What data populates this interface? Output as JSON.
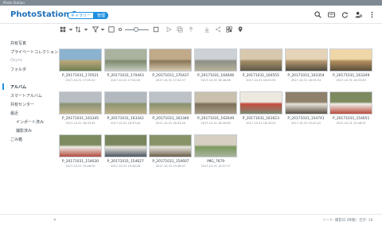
{
  "window": {
    "title": "Photo Station"
  },
  "app": {
    "name": "PhotoStation",
    "version": "5"
  },
  "mode_switch": {
    "gallery": "ギャラリー",
    "manage": "管理"
  },
  "sidebar": {
    "shared_photos": "共有写真",
    "private_collection": "プライベートコレクション",
    "qsync": "Qsync",
    "folder": "フォルダ",
    "album": "アルバム",
    "smart_album": "スマートアルバム",
    "share_center": "共有センター",
    "recent": "最近",
    "imported": "インポート済み",
    "taken": "撮影済み",
    "trash": "ごみ箱"
  },
  "photos": [
    {
      "name": "P_20171031_170521",
      "date": "2017-10-31 17:05:22",
      "colors": [
        "#8bb2cf",
        "#b9a77a",
        "#6f7f52"
      ]
    },
    {
      "name": "P_20171031_170443",
      "date": "2017-10-31 17:04:43",
      "colors": [
        "#a9b39e",
        "#7c8a6d",
        "#c7ccc0"
      ]
    },
    {
      "name": "P_20171031_170437",
      "date": "2017-10-31 17:04:37",
      "colors": [
        "#c0aa8a",
        "#8a7758",
        "#d8c9b0"
      ]
    },
    {
      "name": "P_20171031_164606",
      "date": "2017-10-31 16:46:06",
      "colors": [
        "#ccd2d6",
        "#8d8f86",
        "#b7b29c"
      ]
    },
    {
      "name": "P_20171031_164555",
      "date": "2017-10-31 16:45:55",
      "colors": [
        "#d7c8ae",
        "#a38d66",
        "#5f5a4b"
      ]
    },
    {
      "name": "P_20171031_163354",
      "date": "2017-10-31 16:33:54",
      "colors": [
        "#e6d4b8",
        "#b69871",
        "#4e4a3d"
      ]
    },
    {
      "name": "P_20171031_163349",
      "date": "2017-10-31 16:33:49",
      "colors": [
        "#f0d7a8",
        "#b48f5d",
        "#5a4f3c"
      ]
    },
    {
      "name": "P_20171031_163345",
      "date": "2017-10-31 16:33:45",
      "colors": [
        "#b8bec2",
        "#8a9274",
        "#c2b58f"
      ]
    },
    {
      "name": "P_20171031_163342",
      "date": "2017-10-31 16:33:42",
      "colors": [
        "#b2b9be",
        "#8c9570",
        "#bfb089"
      ]
    },
    {
      "name": "P_20171031_163340",
      "date": "2017-10-31 16:33:40",
      "colors": [
        "#bcc2c6",
        "#88906f",
        "#c4b68f"
      ]
    },
    {
      "name": "P_20171031_162649",
      "date": "2017-10-31 16:26:49",
      "colors": [
        "#c9c0ad",
        "#7e6f58",
        "#a69c87"
      ]
    },
    {
      "name": "P_20171031_161623",
      "date": "2017-10-31 16:16:23",
      "colors": [
        "#ede9e0",
        "#c44b3e",
        "#7c8a73"
      ]
    },
    {
      "name": "P_20171031_154741",
      "date": "2017-10-31 15:47:41",
      "colors": [
        "#8f806c",
        "#e7e2d8",
        "#5d5346"
      ]
    },
    {
      "name": "P_20171031_154651",
      "date": "2017-10-31 15:46:51",
      "colors": [
        "#7d8a5f",
        "#f1efe9",
        "#b94a3c"
      ]
    },
    {
      "name": "P_20171031_154630",
      "date": "2017-10-31 15:46:30",
      "colors": [
        "#7e8b60",
        "#efece6",
        "#b24b3f"
      ]
    },
    {
      "name": "P_20171031_154627",
      "date": "2017-10-31 15:46:28",
      "colors": [
        "#7a875e",
        "#ece9e2",
        "#4c5660"
      ]
    },
    {
      "name": "P_20171031_154607",
      "date": "2017-10-31 15:46:07",
      "colors": [
        "#889468",
        "#eae7df",
        "#6b5e4b"
      ]
    },
    {
      "name": "IMG_7679",
      "date": "2017-10-31 13:57:17",
      "colors": [
        "#d6d0c2",
        "#7c9a5c",
        "#a9b3a0"
      ]
    }
  ],
  "statusbar": {
    "collapse": "«",
    "sort": "ソート: 撮影日 (降順)",
    "total": "合計: 18"
  }
}
